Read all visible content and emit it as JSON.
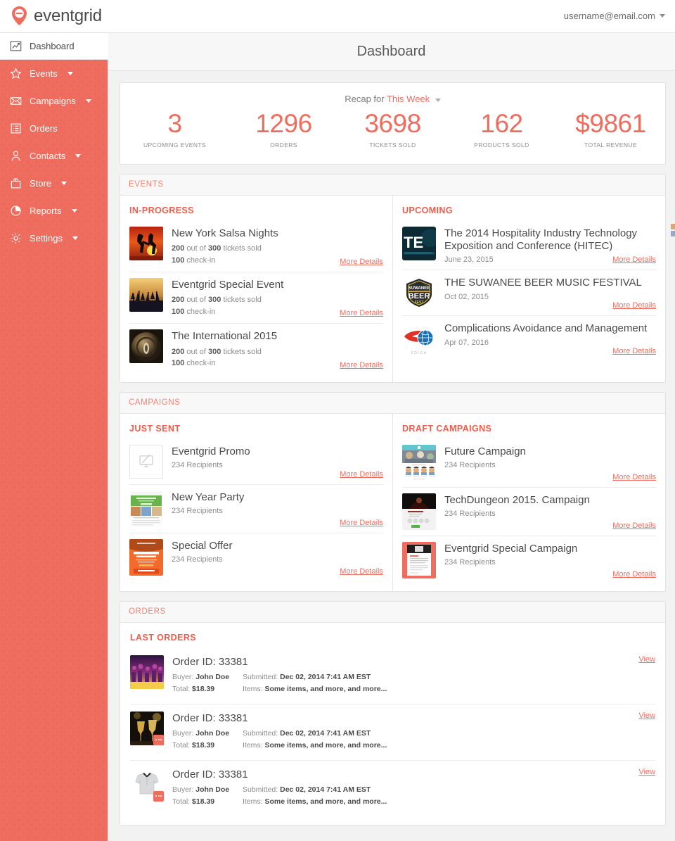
{
  "brand": {
    "name": "eventgrid",
    "accent": "#ef6d5e"
  },
  "topbar": {
    "user_email": "username@email.com"
  },
  "sidebar": {
    "items": [
      {
        "label": "Dashboard",
        "icon": "chart-line-icon",
        "active": true,
        "caret": false
      },
      {
        "label": "Events",
        "icon": "star-icon",
        "active": false,
        "caret": true
      },
      {
        "label": "Campaigns",
        "icon": "envelope-icon",
        "active": false,
        "caret": true
      },
      {
        "label": "Orders",
        "icon": "list-icon",
        "active": false,
        "caret": false
      },
      {
        "label": "Contacts",
        "icon": "user-icon",
        "active": false,
        "caret": true
      },
      {
        "label": "Store",
        "icon": "shopping-bag-icon",
        "active": false,
        "caret": true
      },
      {
        "label": "Reports",
        "icon": "pie-chart-icon",
        "active": false,
        "caret": true
      },
      {
        "label": "Settings",
        "icon": "gear-icon",
        "active": false,
        "caret": true
      }
    ]
  },
  "page": {
    "title": "Dashboard"
  },
  "recap": {
    "prefix": "Recap for",
    "range": "This Week",
    "stats": [
      {
        "value": "3",
        "label": "UPCOMING EVENTS"
      },
      {
        "value": "1296",
        "label": "ORDERS"
      },
      {
        "value": "3698",
        "label": "TICKETS SOLD"
      },
      {
        "value": "162",
        "label": "PRODUCTS SOLD"
      },
      {
        "value": "$9861",
        "label": "TOTAL REVENUE"
      }
    ]
  },
  "events": {
    "section_label": "EVENTS",
    "in_progress": {
      "title": "IN-PROGRESS",
      "items": [
        {
          "name": "New York Salsa Nights",
          "sold": "200",
          "of": "300",
          "sold_text_a": "out of",
          "sold_text_b": "tickets sold",
          "checkin": "100",
          "checkin_text": "check-in",
          "more": "More Details"
        },
        {
          "name": "Eventgrid Special Event",
          "sold": "200",
          "of": "300",
          "sold_text_a": "out of",
          "sold_text_b": "tickets sold",
          "checkin": "100",
          "checkin_text": "check-in",
          "more": "More Details"
        },
        {
          "name": "The International 2015",
          "sold": "200",
          "of": "300",
          "sold_text_a": "out of",
          "sold_text_b": "tickets sold",
          "checkin": "100",
          "checkin_text": "check-in",
          "more": "More Details"
        }
      ]
    },
    "upcoming": {
      "title": "UPCOMING",
      "items": [
        {
          "name": "The 2014 Hospitality Industry Technology Exposition and Conference (HITEC)",
          "date": "June 23, 2015",
          "more": "More Details"
        },
        {
          "name": "THE SUWANEE BEER MUSIC FESTIVAL",
          "date": "Oct 02, 2015",
          "more": "More Details"
        },
        {
          "name": "Complications Avoidance and Management",
          "date": "Apr 07, 2016",
          "more": "More Details"
        }
      ]
    }
  },
  "campaigns": {
    "section_label": "CAMPAIGNS",
    "just_sent": {
      "title": "JUST SENT",
      "items": [
        {
          "name": "Eventgrid Promo",
          "recipients": "234 Recipients",
          "more": "More Details"
        },
        {
          "name": "New Year Party",
          "recipients": "234 Recipients",
          "more": "More Details"
        },
        {
          "name": "Special Offer",
          "recipients": "234 Recipients",
          "more": "More Details"
        }
      ]
    },
    "drafts": {
      "title": "DRAFT CAMPAIGNS",
      "items": [
        {
          "name": "Future Campaign",
          "recipients": "234 Recipients",
          "more": "More Details"
        },
        {
          "name": "TechDungeon 2015. Campaign",
          "recipients": "234 Recipients",
          "more": "More Details"
        },
        {
          "name": "Eventgrid Special Campaign",
          "recipients": "234 Recipients",
          "more": "More Details"
        }
      ]
    }
  },
  "orders": {
    "section_label": "ORDERS",
    "title": "LAST ORDERS",
    "labels": {
      "buyer": "Buyer:",
      "total": "Total:",
      "submitted": "Submitted:",
      "items": "Items:"
    },
    "items": [
      {
        "order_id": "Order ID: 33381",
        "buyer": "John Doe",
        "total": "$18.39",
        "submitted": "Dec 02, 2014 7:41 AM EST",
        "items": "Some items, and more, and more...",
        "view": "View"
      },
      {
        "order_id": "Order ID: 33381",
        "buyer": "John Doe",
        "total": "$18.39",
        "submitted": "Dec 02, 2014 7:41 AM EST",
        "items": "Some items, and more, and more...",
        "view": "View"
      },
      {
        "order_id": "Order ID: 33381",
        "buyer": "John Doe",
        "total": "$18.39",
        "submitted": "Dec 02, 2014 7:41 AM EST",
        "items": "Some items, and more, and more...",
        "view": "View"
      }
    ]
  }
}
